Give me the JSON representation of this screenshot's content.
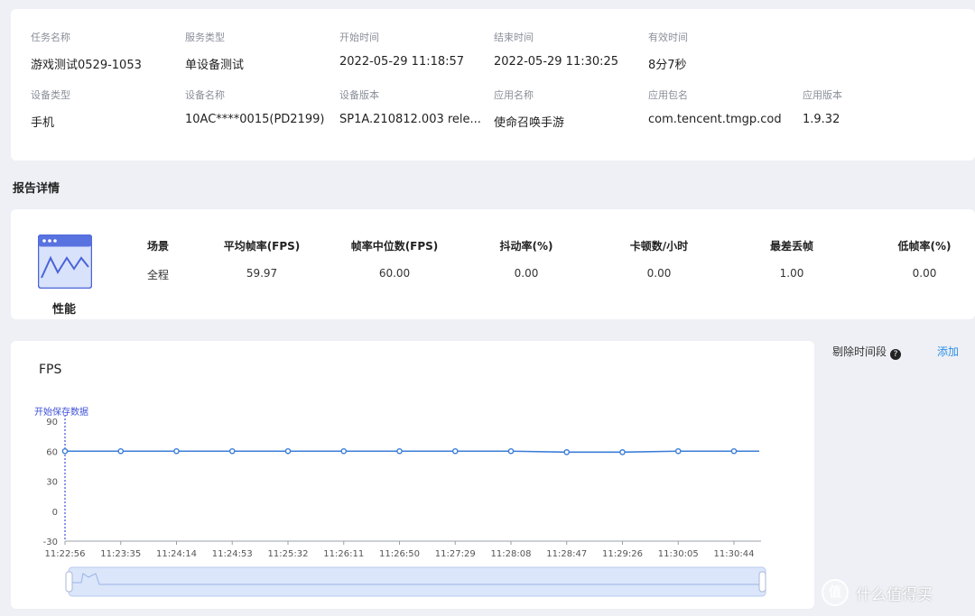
{
  "info": {
    "row1": [
      {
        "label": "任务名称",
        "value": "游戏测试0529-1053"
      },
      {
        "label": "服务类型",
        "value": "单设备测试"
      },
      {
        "label": "开始时间",
        "value": "2022-05-29 11:18:57"
      },
      {
        "label": "结束时间",
        "value": "2022-05-29 11:30:25"
      },
      {
        "label": "有效时间",
        "value": "8分7秒"
      }
    ],
    "row2": [
      {
        "label": "设备类型",
        "value": "手机"
      },
      {
        "label": "设备名称",
        "value": "10AC****0015(PD2199)"
      },
      {
        "label": "设备版本",
        "value": "SP1A.210812.003 rele..."
      },
      {
        "label": "应用名称",
        "value": "使命召唤手游"
      },
      {
        "label": "应用包名",
        "value": "com.tencent.tmgp.cod"
      },
      {
        "label": "应用版本",
        "value": "1.9.32"
      }
    ]
  },
  "section_title": "报告详情",
  "perf": {
    "label": "性能",
    "icon": "performance-chart-icon",
    "columns": [
      {
        "head": "场景",
        "value": "全程"
      },
      {
        "head": "平均帧率(FPS)",
        "value": "59.97"
      },
      {
        "head": "帧率中位数(FPS)",
        "value": "60.00"
      },
      {
        "head": "抖动率(%)",
        "value": "0.00"
      },
      {
        "head": "卡顿数/小时",
        "value": "0.00"
      },
      {
        "head": "最差丢帧",
        "value": "1.00"
      },
      {
        "head": "低帧率(%)",
        "value": "0.00"
      }
    ]
  },
  "chart_title": "FPS",
  "right_panel": {
    "delete_label": "剔除时间段",
    "help_icon": "question-circle-icon",
    "add_label": "添加"
  },
  "watermark": {
    "logo": "值",
    "text": "什么值得买"
  },
  "chart_data": {
    "type": "line",
    "title": "FPS",
    "marker_label": "开始保存数据",
    "x": [
      "11:22:56",
      "11:23:35",
      "11:24:14",
      "11:24:53",
      "11:25:32",
      "11:26:11",
      "11:26:50",
      "11:27:29",
      "11:28:08",
      "11:28:47",
      "11:29:26",
      "11:30:05",
      "11:30:44"
    ],
    "series": [
      {
        "values": [
          60,
          60,
          60,
          60,
          60,
          60,
          60,
          60,
          60,
          59,
          59,
          60,
          60
        ]
      }
    ],
    "yticks": [
      90,
      60,
      30,
      0,
      -30
    ],
    "ylim": [
      -30,
      90
    ],
    "line_color": "#3b7dd8",
    "marker_color": "#3f51d8",
    "grid": false
  }
}
